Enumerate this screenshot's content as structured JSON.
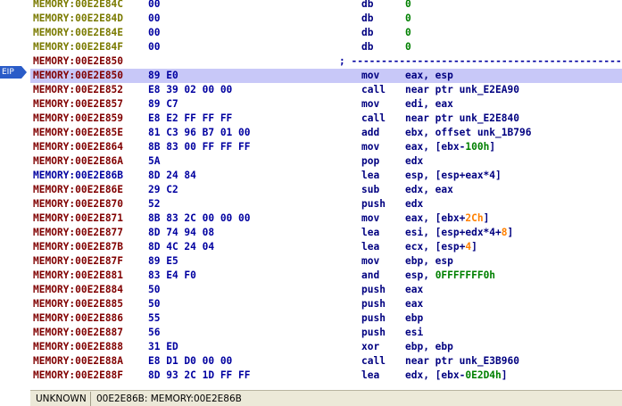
{
  "eip_label": "EIP",
  "rows": [
    {
      "addr": "MEMORY:00E2E84C",
      "kind": "data",
      "bytes": "00",
      "mnem": "db",
      "ops": [
        {
          "t": "0",
          "c": "hexnum"
        }
      ]
    },
    {
      "addr": "MEMORY:00E2E84D",
      "kind": "data",
      "bytes": "00",
      "mnem": "db",
      "ops": [
        {
          "t": "0",
          "c": "hexnum"
        }
      ]
    },
    {
      "addr": "MEMORY:00E2E84E",
      "kind": "data",
      "bytes": "00",
      "mnem": "db",
      "ops": [
        {
          "t": "0",
          "c": "hexnum"
        }
      ]
    },
    {
      "addr": "MEMORY:00E2E84F",
      "kind": "data",
      "bytes": "00",
      "mnem": "db",
      "ops": [
        {
          "t": "0",
          "c": "hexnum"
        }
      ]
    },
    {
      "addr": "MEMORY:00E2E850",
      "kind": "code",
      "bytes": "",
      "mnem": "",
      "ops": [],
      "sep": "; ---------------------------------------------------------------"
    },
    {
      "addr": "MEMORY:00E2E850",
      "kind": "code",
      "bytes": "89 E0",
      "mnem": "mov",
      "ops": [
        {
          "t": "eax, esp",
          "c": "opnd"
        }
      ],
      "highlight": true
    },
    {
      "addr": "MEMORY:00E2E852",
      "kind": "code",
      "bytes": "E8 39 02 00 00",
      "mnem": "call",
      "ops": [
        {
          "t": "near ptr unk_E2EA90",
          "c": "opnd"
        }
      ]
    },
    {
      "addr": "MEMORY:00E2E857",
      "kind": "code",
      "bytes": "89 C7",
      "mnem": "mov",
      "ops": [
        {
          "t": "edi, eax",
          "c": "opnd"
        }
      ]
    },
    {
      "addr": "MEMORY:00E2E859",
      "kind": "code",
      "bytes": "E8 E2 FF FF FF",
      "mnem": "call",
      "ops": [
        {
          "t": "near ptr unk_E2E840",
          "c": "opnd"
        }
      ]
    },
    {
      "addr": "MEMORY:00E2E85E",
      "kind": "code",
      "bytes": "81 C3 96 B7 01 00",
      "mnem": "add",
      "ops": [
        {
          "t": "ebx, offset unk_1B796",
          "c": "opnd"
        }
      ]
    },
    {
      "addr": "MEMORY:00E2E864",
      "kind": "code",
      "bytes": "8B 83 00 FF FF FF",
      "mnem": "mov",
      "ops": [
        {
          "t": "eax, [ebx-",
          "c": "opnd"
        },
        {
          "t": "100h",
          "c": "hexnum"
        },
        {
          "t": "]",
          "c": "opnd"
        }
      ]
    },
    {
      "addr": "MEMORY:00E2E86A",
      "kind": "code",
      "bytes": "5A",
      "mnem": "pop",
      "ops": [
        {
          "t": "edx",
          "c": "opnd"
        }
      ]
    },
    {
      "addr": "MEMORY:00E2E86B",
      "kind": "cur",
      "bytes": "8D 24 84",
      "mnem": "lea",
      "ops": [
        {
          "t": "esp, [esp+eax*4]",
          "c": "opnd"
        }
      ]
    },
    {
      "addr": "MEMORY:00E2E86E",
      "kind": "code",
      "bytes": "29 C2",
      "mnem": "sub",
      "ops": [
        {
          "t": "edx, eax",
          "c": "opnd"
        }
      ]
    },
    {
      "addr": "MEMORY:00E2E870",
      "kind": "code",
      "bytes": "52",
      "mnem": "push",
      "ops": [
        {
          "t": "edx",
          "c": "opnd"
        }
      ]
    },
    {
      "addr": "MEMORY:00E2E871",
      "kind": "code",
      "bytes": "8B 83 2C 00 00 00",
      "mnem": "mov",
      "ops": [
        {
          "t": "eax, [ebx+",
          "c": "opnd"
        },
        {
          "t": "2Ch",
          "c": "num"
        },
        {
          "t": "]",
          "c": "opnd"
        }
      ]
    },
    {
      "addr": "MEMORY:00E2E877",
      "kind": "code",
      "bytes": "8D 74 94 08",
      "mnem": "lea",
      "ops": [
        {
          "t": "esi, [esp+edx*4+",
          "c": "opnd"
        },
        {
          "t": "8",
          "c": "num"
        },
        {
          "t": "]",
          "c": "opnd"
        }
      ]
    },
    {
      "addr": "MEMORY:00E2E87B",
      "kind": "code",
      "bytes": "8D 4C 24 04",
      "mnem": "lea",
      "ops": [
        {
          "t": "ecx, [esp+",
          "c": "opnd"
        },
        {
          "t": "4",
          "c": "num"
        },
        {
          "t": "]",
          "c": "opnd"
        }
      ]
    },
    {
      "addr": "MEMORY:00E2E87F",
      "kind": "code",
      "bytes": "89 E5",
      "mnem": "mov",
      "ops": [
        {
          "t": "ebp, esp",
          "c": "opnd"
        }
      ]
    },
    {
      "addr": "MEMORY:00E2E881",
      "kind": "code",
      "bytes": "83 E4 F0",
      "mnem": "and",
      "ops": [
        {
          "t": "esp, ",
          "c": "opnd"
        },
        {
          "t": "0FFFFFFF0h",
          "c": "hexnum"
        }
      ]
    },
    {
      "addr": "MEMORY:00E2E884",
      "kind": "code",
      "bytes": "50",
      "mnem": "push",
      "ops": [
        {
          "t": "eax",
          "c": "opnd"
        }
      ]
    },
    {
      "addr": "MEMORY:00E2E885",
      "kind": "code",
      "bytes": "50",
      "mnem": "push",
      "ops": [
        {
          "t": "eax",
          "c": "opnd"
        }
      ]
    },
    {
      "addr": "MEMORY:00E2E886",
      "kind": "code",
      "bytes": "55",
      "mnem": "push",
      "ops": [
        {
          "t": "ebp",
          "c": "opnd"
        }
      ]
    },
    {
      "addr": "MEMORY:00E2E887",
      "kind": "code",
      "bytes": "56",
      "mnem": "push",
      "ops": [
        {
          "t": "esi",
          "c": "opnd"
        }
      ]
    },
    {
      "addr": "MEMORY:00E2E888",
      "kind": "code",
      "bytes": "31 ED",
      "mnem": "xor",
      "ops": [
        {
          "t": "ebp, ebp",
          "c": "opnd"
        }
      ]
    },
    {
      "addr": "MEMORY:00E2E88A",
      "kind": "code",
      "bytes": "E8 D1 D0 00 00",
      "mnem": "call",
      "ops": [
        {
          "t": "near ptr unk_E3B960",
          "c": "opnd"
        }
      ]
    },
    {
      "addr": "MEMORY:00E2E88F",
      "kind": "code",
      "bytes": "8D 93 2C 1D FF FF",
      "mnem": "lea",
      "ops": [
        {
          "t": "edx, [ebx-",
          "c": "opnd"
        },
        {
          "t": "0E2D4h",
          "c": "hexnum"
        },
        {
          "t": "]",
          "c": "opnd"
        }
      ]
    }
  ],
  "status": {
    "mode": "UNKNOWN",
    "location": "00E2E86B: MEMORY:00E2E86B"
  }
}
